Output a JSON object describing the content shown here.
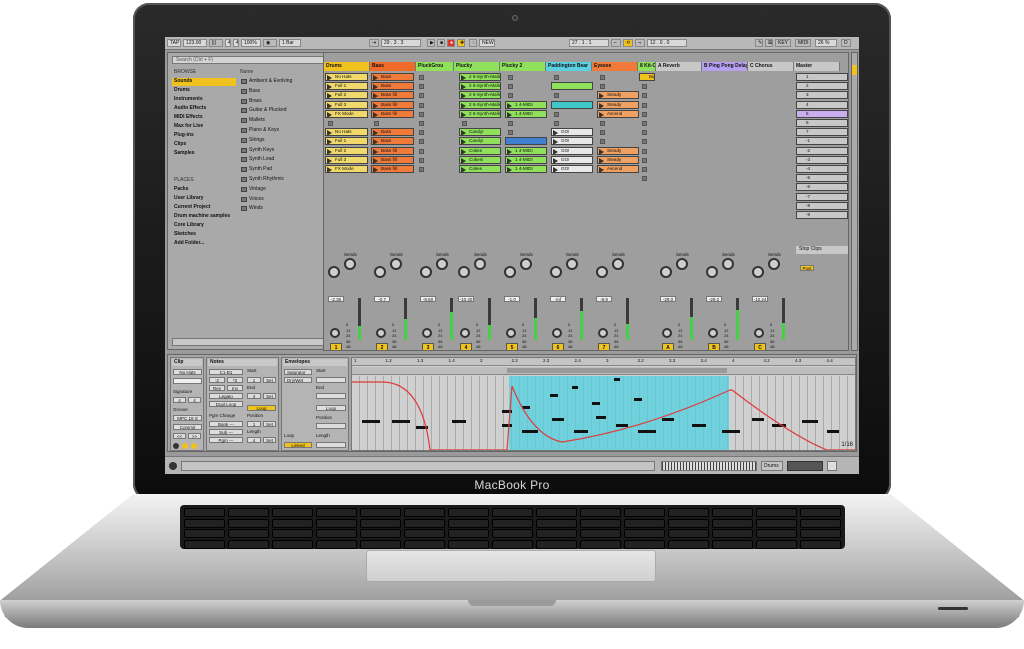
{
  "device": {
    "brand": "MacBook Pro"
  },
  "transport": {
    "tap": "TAP",
    "tempo": "123.00",
    "sig1": "4",
    "sig2": "4",
    "zoom": "100%",
    "quant": "1 Bar",
    "pos": "29 . 3 . 3",
    "new": "NEW",
    "loop_start": "27 . 1 . 1",
    "loop_len": "12 . 0 . 0",
    "key": "KEY",
    "midi": "MIDI",
    "cpu": "26 %",
    "d": "D"
  },
  "browser": {
    "search": "Search (Ctrl + F)",
    "browse": "BROWSE",
    "categories": [
      "Sounds",
      "Drums",
      "Instruments",
      "Audio Effects",
      "MIDI Effects",
      "Max for Live",
      "Plug-ins",
      "Clips",
      "Samples"
    ],
    "places_label": "PLACES",
    "places": [
      "Packs",
      "User Library",
      "Current Project",
      "Drum machine samples",
      "Core Library",
      "Sketches",
      "Add Folder..."
    ],
    "name_header": "Name",
    "folders": [
      "Ambient & Evolving",
      "Bass",
      "Brass",
      "Guitar & Plucked",
      "Mallets",
      "Piano & Keys",
      "Strings",
      "Synth Keys",
      "Synth Lead",
      "Synth Pad",
      "Synth Rhythmic",
      "Vintage",
      "Voices",
      "Winds"
    ]
  },
  "tracks": [
    {
      "name": "Drums",
      "color": "#f0c21e"
    },
    {
      "name": "Bass",
      "color": "#f06a2a"
    },
    {
      "name": "PluckGrou",
      "color": "#8fe05a"
    },
    {
      "name": "Plucky",
      "color": "#8fe05a"
    },
    {
      "name": "Plucky 2",
      "color": "#8fe05a"
    },
    {
      "name": "Paddington Bear",
      "color": "#5ad0e0"
    },
    {
      "name": "Eyesee",
      "color": "#f07a3a"
    },
    {
      "name": "8 Kit-C",
      "color": "#8fe05a"
    },
    {
      "name": "A Reverb",
      "color": "#c8c8c8"
    },
    {
      "name": "B Ping Pong Delay",
      "color": "#b8a0f0"
    },
    {
      "name": "C Chorus",
      "color": "#c8c8c8"
    },
    {
      "name": "Master",
      "color": "#c8c8c8"
    }
  ],
  "clips": {
    "drums": [
      "No Hats",
      "Full 1",
      "Full 2",
      "Full 3",
      "FX Mode",
      "",
      "No Hats",
      "Full 1",
      "Full 2",
      "Full 3",
      "FX Mode"
    ],
    "bass": [
      "Bass",
      "Bass",
      "Bass fill",
      "Bass fill",
      "Bass fill",
      "",
      "Bass",
      "Bass",
      "Bass fill",
      "Bass fill",
      "Bass fill"
    ],
    "plucky": [
      "2 6-Synth-Mallet",
      "2 6-Synth-Mallet",
      "2 6-Synth-Mallet",
      "2 6-Synth-Mallet",
      "2 6-Synth-Mallet",
      "",
      "Candy!",
      "Candy!",
      "Cokes",
      "Cokes!",
      "Cokes"
    ],
    "plucky2": [
      "",
      "",
      "",
      "1 4-MIDI",
      "1 4-MIDI",
      "",
      "",
      "",
      "1 4-MIDI",
      "1 4-MIDI",
      "1 4-MIDI"
    ],
    "paddington": [
      "",
      "",
      "",
      "",
      "",
      "",
      "GO!",
      "GO!",
      "GO!",
      "GO!",
      "GO!"
    ],
    "eyesee": [
      "",
      "",
      "Steady",
      "Steady",
      "Ascend",
      "",
      "",
      "",
      "Steady",
      "Steady",
      "Ascend"
    ],
    "kit": [
      "Big",
      ""
    ],
    "scenes": [
      "1",
      "2",
      "3",
      "4",
      "5",
      "6",
      "7",
      "-1",
      "-2",
      "-3",
      "-4",
      "-5",
      "-6",
      "-7",
      "-8",
      "-9"
    ]
  },
  "mixer": {
    "sends": "Sends",
    "stop_clips": "Stop Clips",
    "values": [
      "-2.36",
      "-0.7",
      "-8.60",
      "-10.40",
      "-1.0",
      "-inf",
      "-9.9",
      "-29.0",
      "-29.2",
      "-10.24",
      "-85.46"
    ],
    "numbers": [
      "1",
      "2",
      "3",
      "4",
      "5",
      "6",
      "7",
      "A",
      "B",
      "C"
    ],
    "scale": [
      "0",
      "12",
      "24",
      "36",
      "48"
    ],
    "post": "Post"
  },
  "clip_panel": {
    "title": "Clip",
    "name": "No Hats",
    "signature": "Signature",
    "sig_num": "4",
    "sig_den": "4",
    "groove": "Groove",
    "groove_val": "MPC 16 S",
    "commit": "Commit"
  },
  "notes_panel": {
    "title": "Notes",
    "start": "Start",
    "end": "End",
    "set": "Set",
    "c1": "C1-B1",
    "fold": "Fold",
    "legato": "Legato",
    "dupl": "Dupl.Loop",
    "loop": "Loop",
    "position": "Position",
    "length": "Length",
    "pgm_change": "Pgm Change",
    "bank": "Bank ---",
    "sub": "Sub ---",
    "pgm": "Pgm ---",
    "len_val": "4",
    "pos_val": "1"
  },
  "env_panel": {
    "title": "Envelopes",
    "device": "Saturator",
    "param": "Dry/Wet",
    "start": "Start",
    "end": "End",
    "loop": "Loop",
    "position": "Position",
    "length": "Length",
    "linked": "Linked"
  },
  "ruler": [
    "1",
    "1.2",
    "1.3",
    "1.4",
    "2",
    "2.2",
    "2.3",
    "2.4",
    "3",
    "3.2",
    "3.3",
    "3.4",
    "4",
    "4.2",
    "4.3",
    "4.4"
  ],
  "grid_label": "1/16",
  "status_track": "Drums"
}
